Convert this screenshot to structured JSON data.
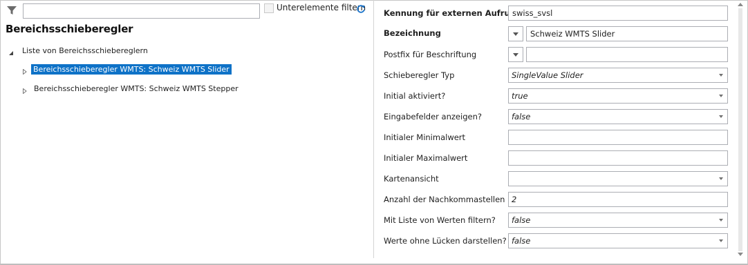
{
  "left_panel": {
    "filter_placeholder": "",
    "subelements_filter_label": "Unterelemente filtern",
    "title": "Bereichsschieberegler",
    "tree": {
      "root_label": "Liste von Bereichsschiebereglern",
      "items": [
        {
          "label": "Bereichsschieberegler WMTS: Schweiz WMTS Slider",
          "selected": true
        },
        {
          "label": "Bereichsschieberegler WMTS: Schweiz WMTS Stepper",
          "selected": false
        }
      ]
    }
  },
  "form": {
    "external_id": {
      "label": "Kennung für externen Aufruf",
      "value": "swiss_svsl"
    },
    "designation": {
      "label": "Bezeichnung",
      "value": "Schweiz WMTS Slider"
    },
    "postfix": {
      "label": "Postfix für Beschriftung",
      "value": ""
    },
    "slider_type": {
      "label": "Schieberegler Typ",
      "value": "SingleValue Slider"
    },
    "initially_activated": {
      "label": "Initial aktiviert?",
      "value": "true"
    },
    "show_input_fields": {
      "label": "Eingabefelder anzeigen?",
      "value": "false"
    },
    "initial_min": {
      "label": "Initialer Minimalwert",
      "value": ""
    },
    "initial_max": {
      "label": "Initialer Maximalwert",
      "value": ""
    },
    "map_view": {
      "label": "Kartenansicht",
      "value": ""
    },
    "decimal_places": {
      "label": "Anzahl der Nachkommastellen",
      "value": "2"
    },
    "filter_with_value_list": {
      "label": "Mit Liste von Werten filtern?",
      "value": "false"
    },
    "values_without_gaps": {
      "label": "Werte ohne Lücken darstellen?",
      "value": "false"
    }
  },
  "colors": {
    "selection": "#0e72c7",
    "accent_icon": "#1a73c9"
  }
}
